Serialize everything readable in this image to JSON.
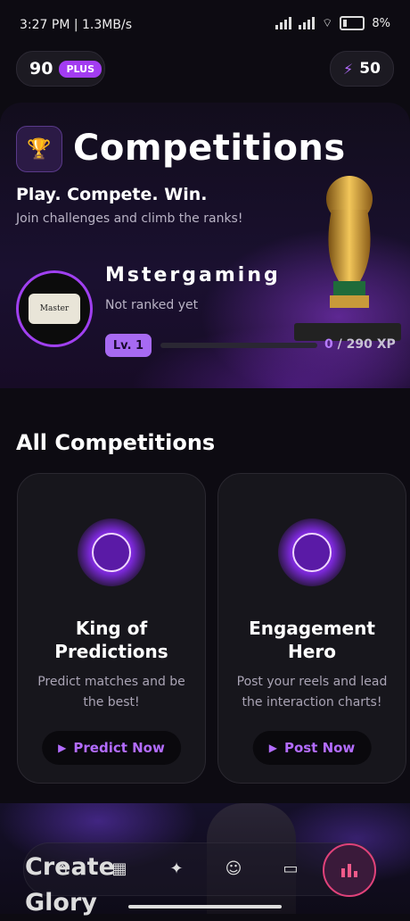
{
  "status_bar": {
    "time": "3:27 PM | 1.3MB/s",
    "battery": "8%"
  },
  "top_bar": {
    "coins": "90",
    "plan_badge": "PLUS",
    "energy": "50"
  },
  "hero": {
    "title": "Competitions",
    "tagline": "Play. Compete. Win.",
    "subtitle": "Join challenges and climb the ranks!"
  },
  "profile": {
    "avatar_text": "Master",
    "username": "Mstergaming",
    "rank": "Not ranked yet",
    "level": "Lv. 1",
    "xp_current": "0",
    "xp_total": " / 290 XP",
    "xp_progress": 0
  },
  "section": {
    "title": "All Competitions"
  },
  "competitions": [
    {
      "title": "King of Predictions",
      "description": "Predict matches and be the best!",
      "button": "Predict Now",
      "icon": "soccer-ball-icon"
    },
    {
      "title": "Engagement Hero",
      "description": "Post your reels and lead the interaction charts!",
      "button": "Post Now",
      "icon": "most-engaging-badge-icon"
    }
  ],
  "bottom": {
    "banner_text_line1": "Create",
    "banner_text_line2": "Glory"
  },
  "nav": {
    "items": [
      "home-icon",
      "stadium-icon",
      "sparkles-icon",
      "profile-icon",
      "video-icon",
      "leaderboard-icon"
    ],
    "active": "leaderboard-icon"
  },
  "colors": {
    "accent": "#a33cf2",
    "accent_text": "#b36cff",
    "background": "#0d0b12",
    "nav_active_ring": "#e0427a"
  }
}
